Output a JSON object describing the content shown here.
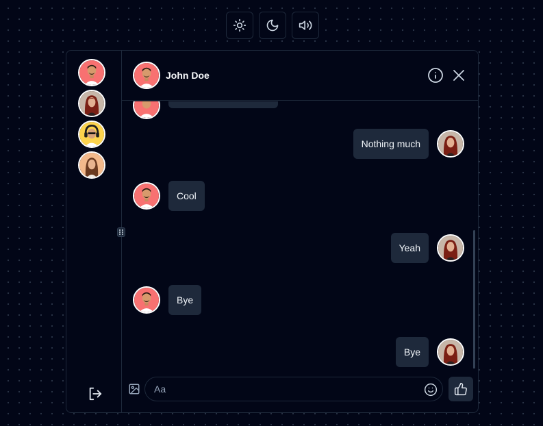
{
  "topbar": {
    "icons": [
      "sun-icon",
      "moon-icon",
      "volume-icon"
    ]
  },
  "sidebar": {
    "contacts": [
      {
        "avatar": "man-avatar",
        "bg": "#f87171"
      },
      {
        "avatar": "woman-red-hair-avatar",
        "bg": "#c7b6a8"
      },
      {
        "avatar": "man-headphones-avatar",
        "bg": "#fcd34d"
      },
      {
        "avatar": "woman-avatar",
        "bg": "#f3b98b"
      }
    ],
    "logout_icon": "logout-icon"
  },
  "chat": {
    "contact_name": "John Doe",
    "messages": [
      {
        "side": "right",
        "text": "Nothing much"
      },
      {
        "side": "left",
        "text": "Cool"
      },
      {
        "side": "right",
        "text": "Yeah"
      },
      {
        "side": "left",
        "text": "Bye"
      },
      {
        "side": "right",
        "text": "Bye"
      }
    ]
  },
  "composer": {
    "placeholder": "Aa"
  },
  "colors": {
    "background": "#020617",
    "border": "#1e293b",
    "bubble": "#1e293b",
    "text": "#f1f5f9"
  }
}
